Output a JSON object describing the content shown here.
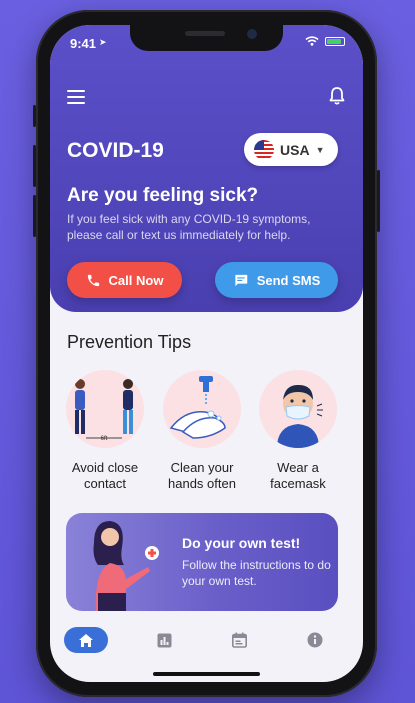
{
  "status": {
    "time": "9:41"
  },
  "header": {
    "title": "COVID-19",
    "country": "USA",
    "question": "Are you feeling sick?",
    "description": "If you feel sick with any COVID-19 symptoms, please call or text us immediately for help.",
    "call_label": "Call Now",
    "sms_label": "Send SMS"
  },
  "prevention": {
    "title": "Prevention Tips",
    "tips": [
      {
        "label": "Avoid close contact",
        "distance": "6ft"
      },
      {
        "label": "Clean your hands often"
      },
      {
        "label": "Wear a facemask"
      }
    ]
  },
  "test_card": {
    "title": "Do your own test!",
    "description": "Follow the instructions to do your own test."
  },
  "tabs": [
    {
      "icon": "home-icon",
      "active": true
    },
    {
      "icon": "chart-icon",
      "active": false
    },
    {
      "icon": "calendar-icon",
      "active": false
    },
    {
      "icon": "info-icon",
      "active": false
    }
  ],
  "colors": {
    "accent": "#5b50c9",
    "call": "#f25047",
    "sms": "#3f9bea",
    "active_tab": "#3b6fd8"
  }
}
